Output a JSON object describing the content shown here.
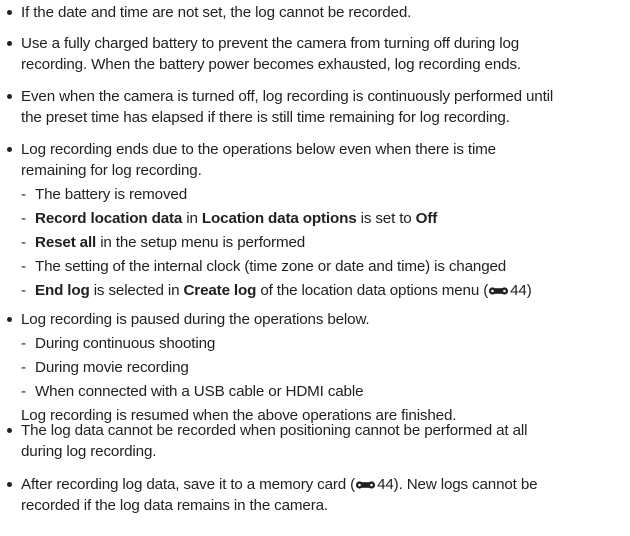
{
  "bullets": [
    {
      "lines": [
        "If the date and time are not set, the log cannot be recorded."
      ]
    },
    {
      "lines": [
        "Use a fully charged battery to prevent the camera from turning off during log",
        "recording. When the battery power becomes exhausted, log recording ends."
      ]
    },
    {
      "lines": [
        "Even when the camera is turned off, log recording is continuously performed until",
        "the preset time has elapsed if there is still time remaining for log recording."
      ]
    },
    {
      "lines": [
        "Log recording ends due to the operations below even when there is time",
        "remaining for log recording."
      ]
    }
  ],
  "end_items": {
    "dash": "-",
    "item1": "The battery is removed",
    "item2_b1": "Record location data",
    "item2_t1": " in ",
    "item2_b2": "Location data options",
    "item2_t2": " is set to ",
    "item2_b3": "Off",
    "item3_b1": "Reset all",
    "item3_t1": " in the setup menu is performed",
    "item4": "The setting of the internal clock (time zone or date and time) is changed",
    "item5_b1": "End log",
    "item5_t1": " is selected in ",
    "item5_b2": "Create log",
    "item5_t2": " of the location data options menu (",
    "item5_ref": "44",
    "item5_t3": ")"
  },
  "pause_bullet": "Log recording is paused during the operations below.",
  "pause_items": [
    "During continuous shooting",
    "During movie recording",
    "When connected with a USB cable or HDMI cable"
  ],
  "resume_text": "Log recording is resumed when the above operations are finished.",
  "positioning_bullet": [
    "The log data cannot be recorded when positioning cannot be performed at all",
    "during log recording."
  ],
  "save_bullet": {
    "l1_t1": "After recording log data, save it to a memory card (",
    "l1_ref": "44",
    "l1_t2": "). New logs cannot be",
    "l2": "recorded if the log data remains in the camera."
  },
  "icons": {
    "reference": "reference-page-icon"
  },
  "colors": {
    "text": "#231f20"
  }
}
